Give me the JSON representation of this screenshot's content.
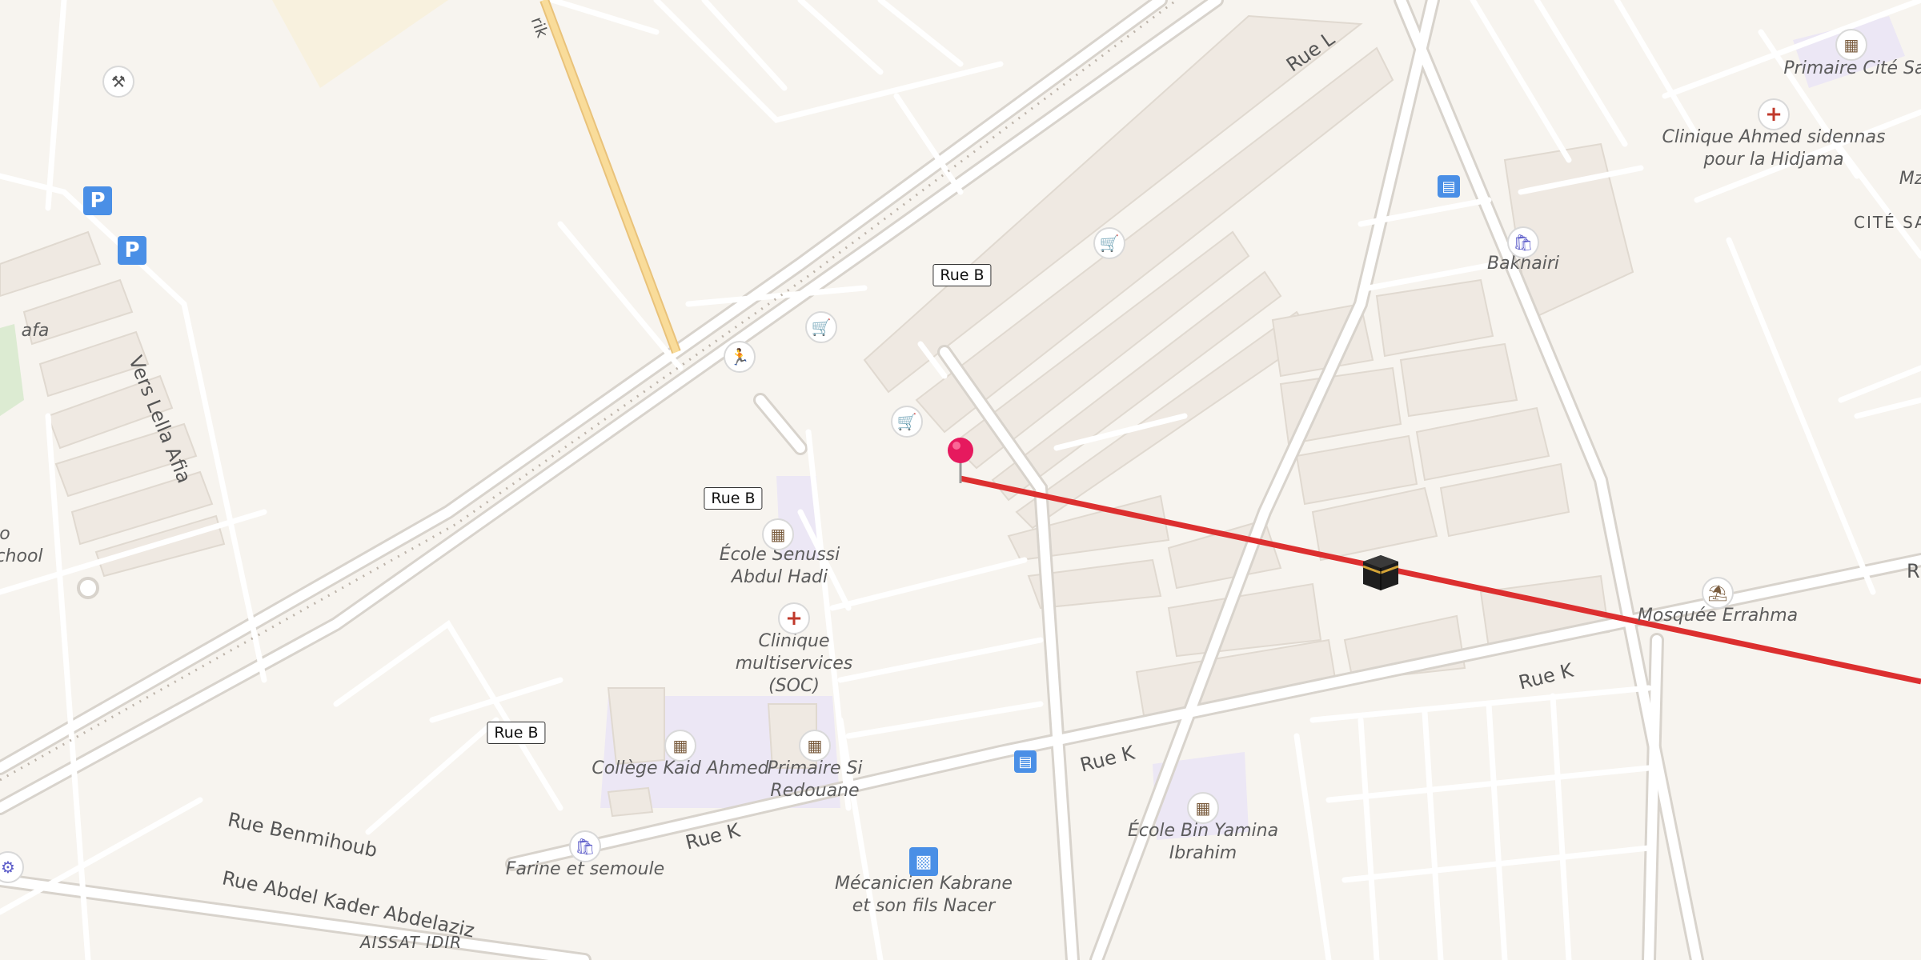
{
  "colors": {
    "background": "#f7f4ef",
    "road": "#ffffff",
    "road_casing": "#d6d2cc",
    "building": "#efe9e2",
    "school_area": "#ece7f5",
    "route_line": "#dc2f2f",
    "pin": "#e6195e",
    "highlight_road": "#f9dc9a"
  },
  "street_labels": {
    "rue_b_1": "Rue B",
    "rue_b_2": "Rue B",
    "rue_b_3": "Rue B",
    "rue_l": "Rue L",
    "rue_k_1": "Rue K",
    "rue_k_2": "Rue K",
    "rue_k_3": "Rue K",
    "rue_benmihoub": "Rue Benmihoub",
    "rue_abdel_kader": "Rue Abdel Kader Abdelaziz",
    "vers_lella_afia": "Vers Lella Afia",
    "rue_r": "R",
    "rik": "rik"
  },
  "place_labels": {
    "ecole_senussi": [
      "École Senussi",
      "Abdul Hadi"
    ],
    "clinique_multiservices": [
      "Clinique",
      "multiservices",
      "(SOC)"
    ],
    "college_kaid": [
      "Collège Kaid Ahmed"
    ],
    "primaire_si_redouane": [
      "Primaire Si",
      "Redouane"
    ],
    "farine_semoule": [
      "Farine et semoule"
    ],
    "mecanicien": [
      "Mécanicien Kabrane",
      "et son fils Nacer"
    ],
    "ecole_bin_yamina": [
      "École Bin Yamina",
      "Ibrahim"
    ],
    "mosquee_errahma": [
      "Mosquée Errahma"
    ],
    "bakhairi": [
      "Bakhairi"
    ],
    "clinique_ahmed": [
      "Clinique Ahmed sidennas",
      "pour la Hidjama"
    ],
    "primaire_cite": [
      "Primaire Cité Sata"
    ],
    "cite_sat": "CITÉ SAT",
    "aissat_idir": "AISSAT IDIR",
    "afa": "afa",
    "chool": "chool",
    "mz": "Mz",
    "o": "o"
  },
  "icons": {
    "parking_1": "P",
    "parking_2": "P",
    "bus_1": "bus-icon",
    "bus_2": "bus-icon",
    "car": "car-icon",
    "kaaba": "kaaba-icon",
    "pin": "map-pin-icon"
  }
}
